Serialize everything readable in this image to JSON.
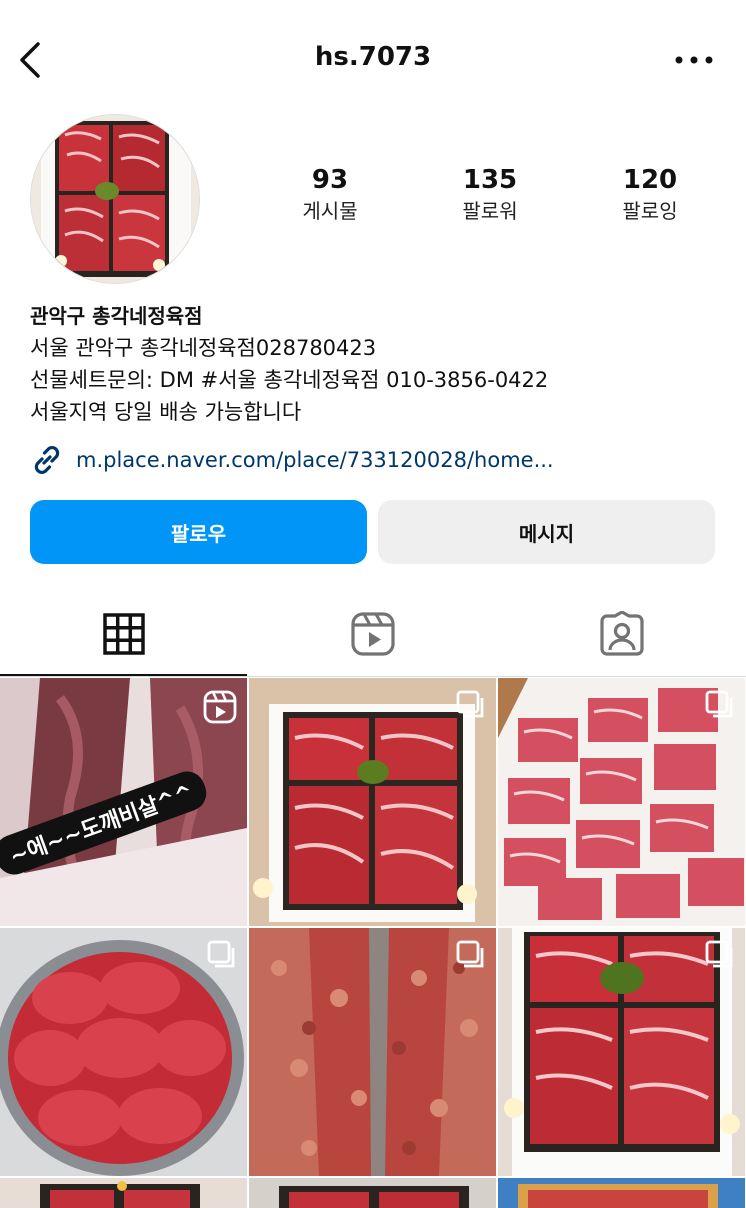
{
  "header": {
    "username": "hs.7073"
  },
  "profile": {
    "stats": [
      {
        "value": "93",
        "label": "게시물"
      },
      {
        "value": "135",
        "label": "팔로워"
      },
      {
        "value": "120",
        "label": "팔로잉"
      }
    ],
    "name": "관악구 총각네정육점",
    "bio_lines": [
      "서울 관악구 총각네정육점028780423",
      "선물세트문의: DM #서울 총각네정육점 010-3856-0422",
      "서울지역 당일 배송 가능합니다"
    ],
    "link": "m.place.naver.com/place/733120028/home..."
  },
  "actions": {
    "follow_label": "팔로우",
    "message_label": "메시지"
  },
  "tabs": [
    {
      "icon": "grid-icon",
      "active": true
    },
    {
      "icon": "reels-icon",
      "active": false
    },
    {
      "icon": "tagged-icon",
      "active": false
    }
  ],
  "posts": {
    "first_caption": "~에~~도깨비살^^"
  },
  "colors": {
    "accent": "#0095f6",
    "link": "#00376b",
    "secondary_button": "#efefef"
  }
}
